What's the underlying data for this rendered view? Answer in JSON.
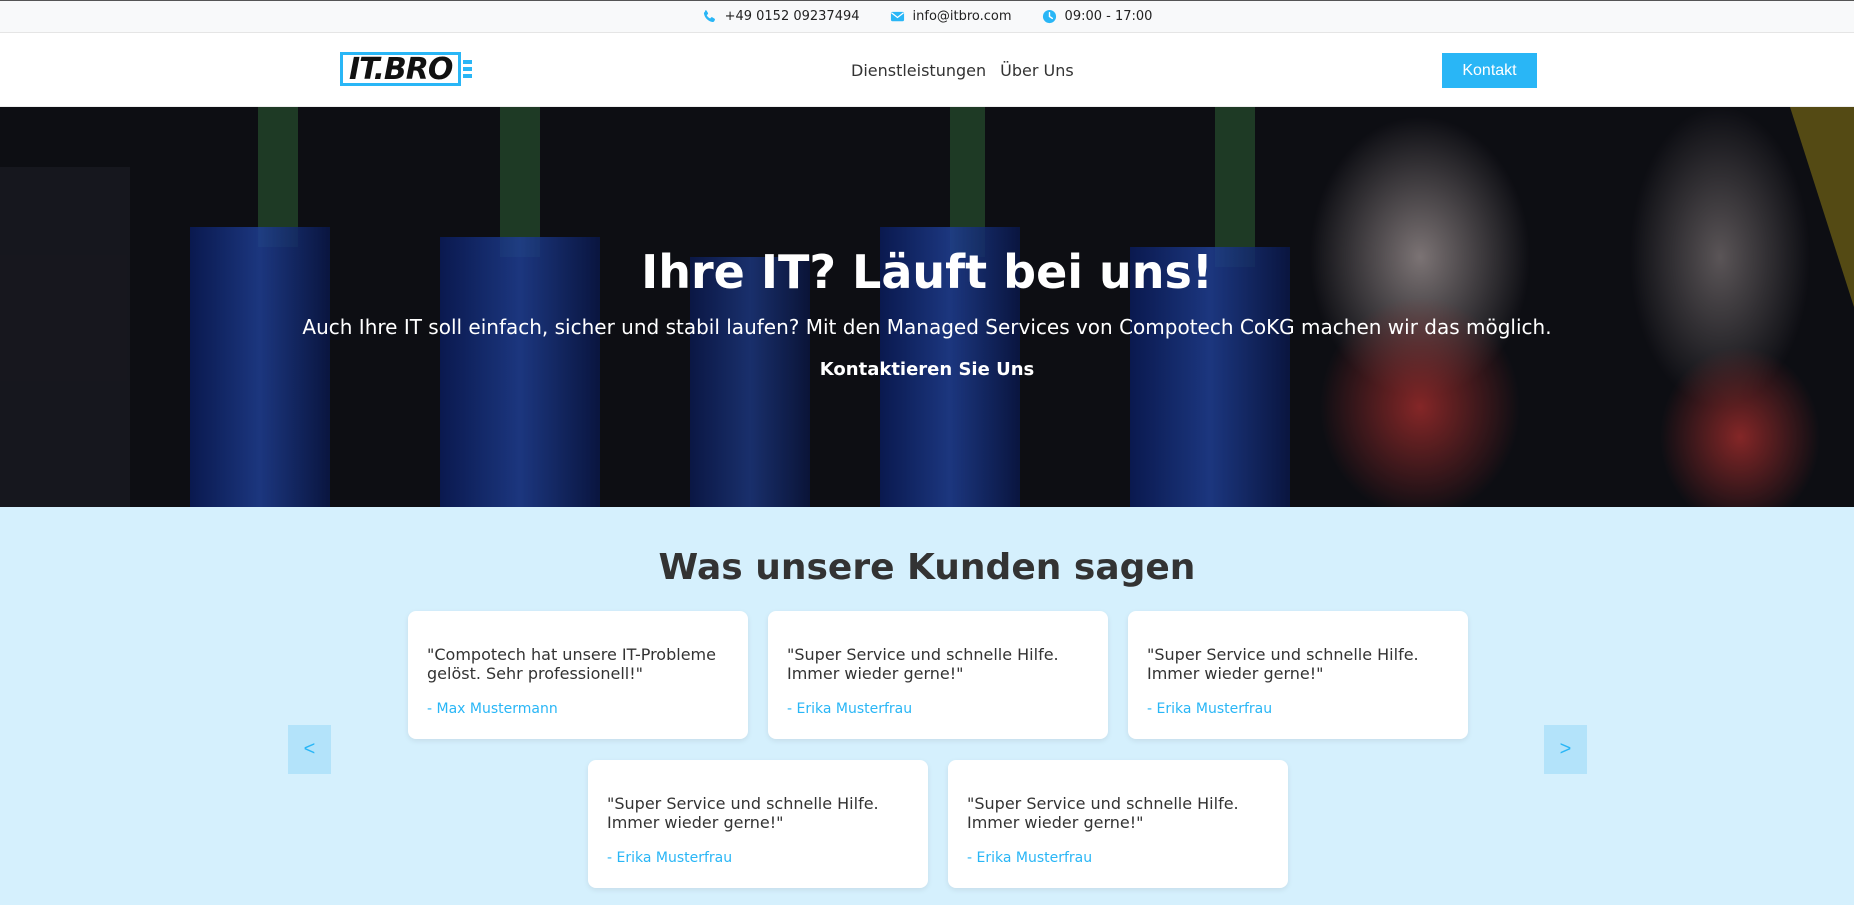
{
  "topbar": {
    "phone": "+49 0152 09237494",
    "email": "info@itbro.com",
    "hours": "09:00 - 17:00"
  },
  "header": {
    "logo_text": "IT.BRO",
    "nav": [
      "Dienstleistungen",
      "Über Uns"
    ],
    "cta": "Kontakt"
  },
  "hero": {
    "title": "Ihre IT? Läuft bei uns!",
    "subtitle": "Auch Ihre IT soll einfach, sicher und stabil laufen? Mit den Managed Services von Compotech CoKG machen wir das möglich.",
    "cta": "Kontaktieren Sie Uns"
  },
  "testimonials": {
    "title": "Was unsere Kunden sagen",
    "prev": "<",
    "next": ">",
    "items": [
      {
        "quote": "\"Compotech hat unsere IT-Probleme gelöst. Sehr professionell!\"",
        "author": "- Max Mustermann"
      },
      {
        "quote": "\"Super Service und schnelle Hilfe. Immer wieder gerne!\"",
        "author": "- Erika Musterfrau"
      },
      {
        "quote": "\"Super Service und schnelle Hilfe. Immer wieder gerne!\"",
        "author": "- Erika Musterfrau"
      },
      {
        "quote": "\"Super Service und schnelle Hilfe. Immer wieder gerne!\"",
        "author": "- Erika Musterfrau"
      },
      {
        "quote": "\"Super Service und schnelle Hilfe. Immer wieder gerne!\"",
        "author": "- Erika Musterfrau"
      }
    ]
  },
  "colors": {
    "accent": "#29b6f6",
    "testimonials_bg": "#d5f0fd"
  }
}
